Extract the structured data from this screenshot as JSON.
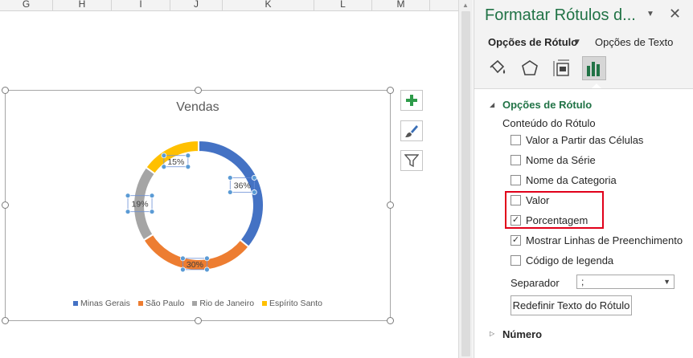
{
  "columns": [
    "G",
    "H",
    "I",
    "J",
    "K",
    "L",
    "M"
  ],
  "chart": {
    "buttons": [
      {
        "name": "chart-elements-button",
        "icon": "plus-icon"
      },
      {
        "name": "chart-styles-button",
        "icon": "paintbrush-icon"
      },
      {
        "name": "chart-filters-button",
        "icon": "filter-icon"
      }
    ]
  },
  "chart_data": {
    "type": "pie",
    "variant": "donut",
    "title": "Vendas",
    "categories": [
      "Minas Gerais",
      "São Paulo",
      "Rio de Janeiro",
      "Espírito Santo"
    ],
    "values": [
      36,
      30,
      19,
      15
    ],
    "labels": [
      "36%",
      "30%",
      "19%",
      "15%"
    ],
    "colors": [
      "#4472c4",
      "#ed7d31",
      "#a5a5a5",
      "#ffc000"
    ],
    "legend_position": "bottom"
  },
  "pane": {
    "title": "Formatar Rótulos d...",
    "tab_rotulo": "Opções de Rótulo",
    "tab_texto": "Opções de Texto",
    "icons": [
      "fill-line-icon",
      "effects-pentagon-icon",
      "size-properties-icon",
      "label-options-bar-chart-icon"
    ],
    "section_rotulo": "Opções de Rótulo",
    "conteudo_label": "Conteúdo do Rótulo",
    "options": [
      {
        "label": "Valor a Partir das Células",
        "checked": false
      },
      {
        "label": "Nome da Série",
        "checked": false
      },
      {
        "label": "Nome da Categoria",
        "checked": false
      },
      {
        "label": "Valor",
        "checked": false
      },
      {
        "label": "Porcentagem",
        "checked": true
      },
      {
        "label": "Mostrar Linhas de Preenchimento",
        "checked": true
      },
      {
        "label": "Código de legenda",
        "checked": false
      }
    ],
    "separator_label": "Separador",
    "separator_value": ";",
    "reset_button": "Redefinir Texto do Rótulo",
    "section_numero": "Número",
    "accent": "#217346",
    "highlight": "#e1001a"
  }
}
